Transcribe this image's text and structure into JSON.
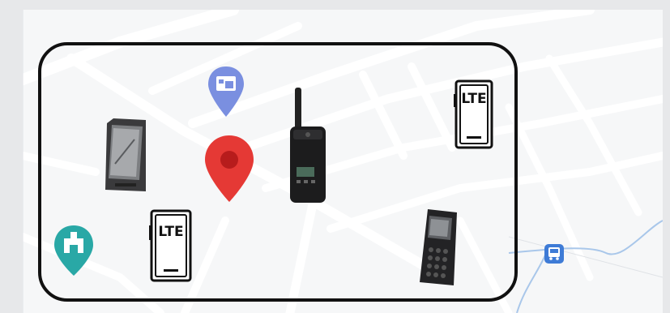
{
  "map": {
    "background": "#f6f7f8",
    "road_color": "#ffffff",
    "river_color": "#a9c7ea"
  },
  "geofence": {
    "border_color": "#111111"
  },
  "devices": {
    "lte_badge_top": {
      "label": "LTE"
    },
    "lte_badge_bottom": {
      "label": "LTE"
    },
    "rugged_smartphone": {
      "icon": "rugged-smartphone-icon"
    },
    "radio": {
      "icon": "two-way-radio-icon"
    },
    "feature_phone": {
      "icon": "feature-phone-icon"
    }
  },
  "markers": {
    "location_pin": {
      "icon": "map-pin-icon",
      "color": "#e53935"
    },
    "place_pin": {
      "icon": "hotel-place-pin-icon",
      "color": "#7a8fe0"
    },
    "landmark_pin": {
      "icon": "landmark-pin-icon",
      "color": "#29a8a6"
    },
    "transit": {
      "icon": "bus-stop-icon",
      "color": "#3e7bd6"
    }
  }
}
